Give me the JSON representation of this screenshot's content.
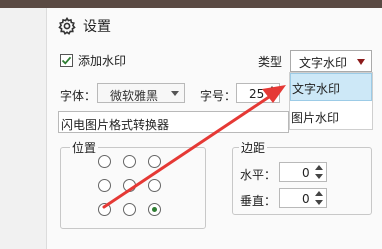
{
  "panel": {
    "title": "设置",
    "title_icon": "gear-icon"
  },
  "watermark": {
    "enabled": true,
    "checkbox_label": "添加水印",
    "type_label": "类型",
    "type_selected": "文字水印",
    "type_options": [
      "文字水印",
      "图片水印"
    ],
    "type_options_visible": [
      "文字水印",
      "图片水印"
    ],
    "caret_color": "#8b1a1a"
  },
  "font": {
    "label": "字体：",
    "selected": "微软雅黑",
    "size_label": "字号：",
    "size_value": "25"
  },
  "text_input": {
    "value": "闪电图片格式转换器"
  },
  "position": {
    "legend": "位置",
    "selected_cell": "bottom-right"
  },
  "margin": {
    "legend": "边距",
    "horizontal_label": "水平：",
    "horizontal_value": "0",
    "vertical_label": "垂直：",
    "vertical_value": "0"
  },
  "annotation": {
    "arrow_color": "#e53935"
  }
}
